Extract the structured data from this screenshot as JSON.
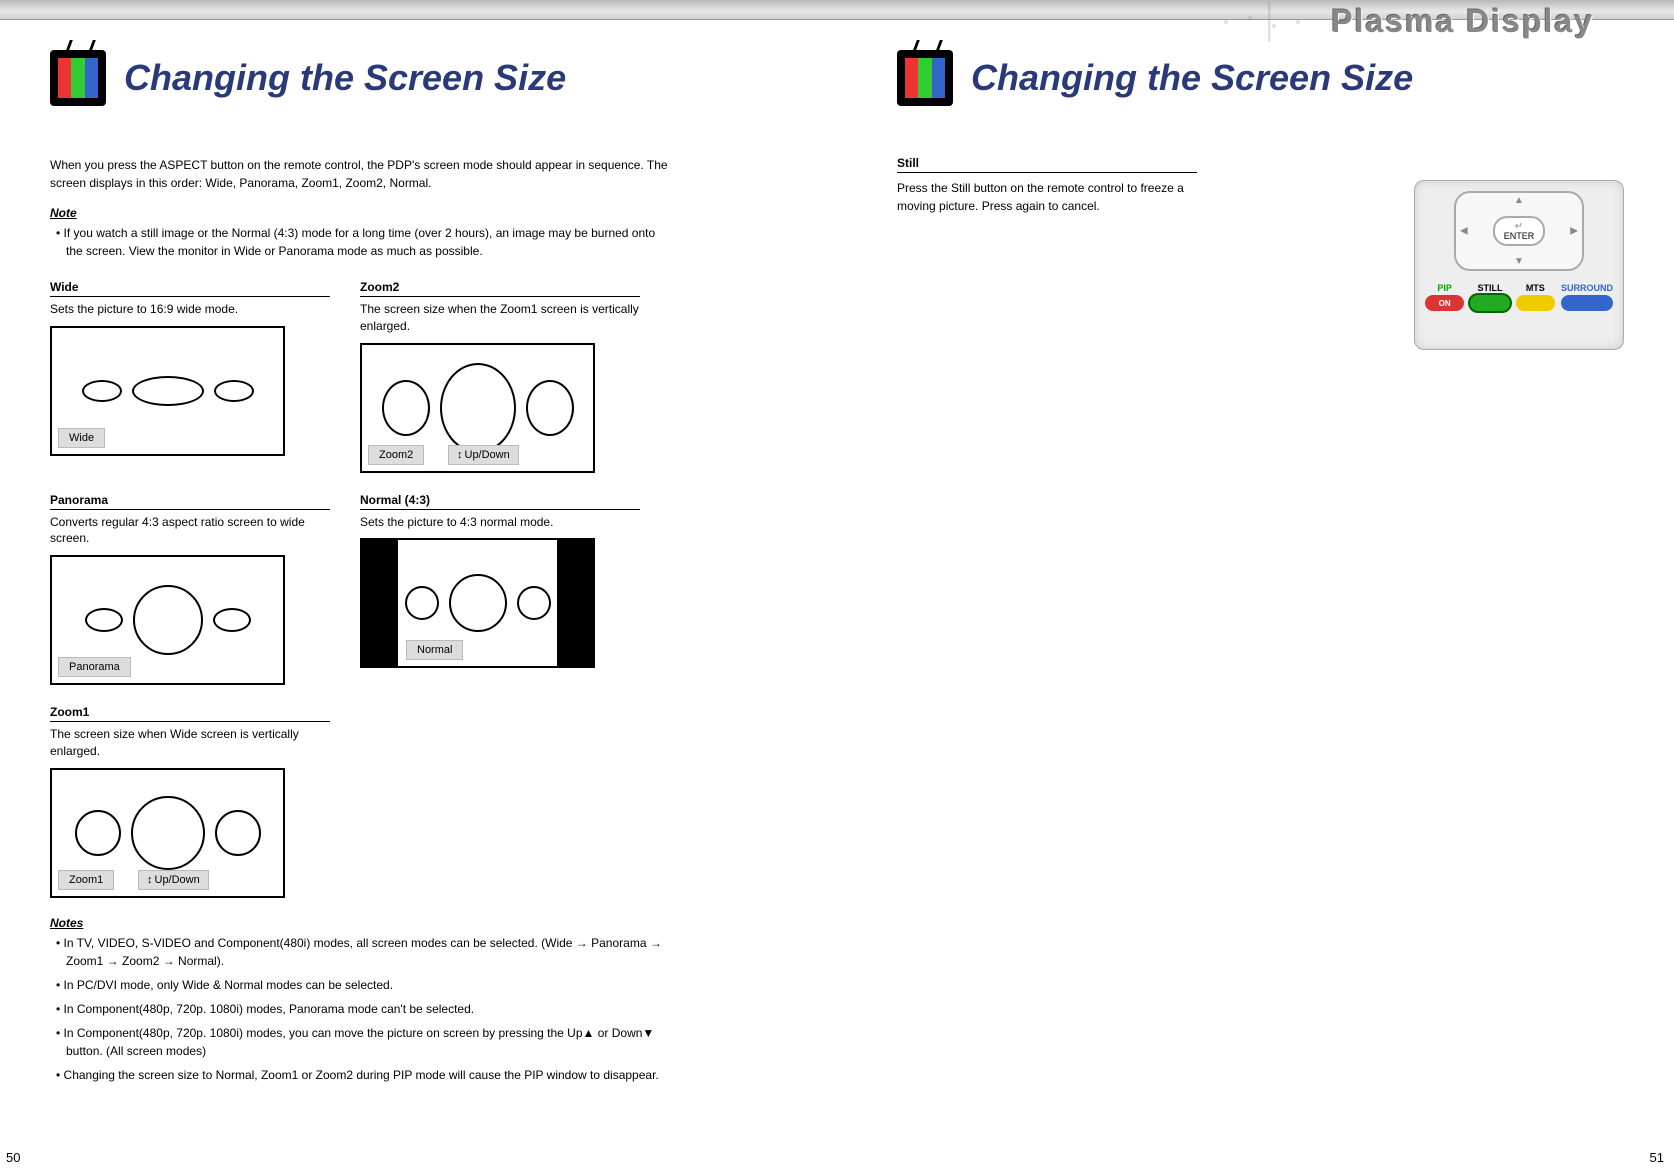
{
  "brand": "Plasma Display",
  "left": {
    "title": "Changing the Screen Size",
    "intro": "When you press the ASPECT button on the remote control, the PDP's screen mode should appear in sequence. The screen displays in this order: Wide, Panorama, Zoom1, Zoom2, Normal.",
    "note_heading": "Note",
    "note_bullet": "If you watch a still image or the Normal (4:3) mode for a long time (over 2 hours), an image may be burned onto the screen. View the monitor in Wide or Panorama mode as much as possible.",
    "modes": {
      "wide": {
        "title": "Wide",
        "desc": "Sets the picture to 16:9 wide mode.",
        "tag": "Wide"
      },
      "zoom2": {
        "title": "Zoom2",
        "desc": "The screen size when the Zoom1 screen is vertically enlarged.",
        "tag": "Zoom2",
        "updown": "Up/Down"
      },
      "panorama": {
        "title": "Panorama",
        "desc": "Converts regular 4:3 aspect ratio screen to wide screen.",
        "tag": "Panorama"
      },
      "normal": {
        "title": "Normal (4:3)",
        "desc": "Sets the picture to 4:3 normal mode.",
        "tag": "Normal"
      },
      "zoom1": {
        "title": "Zoom1",
        "desc": "The screen size when Wide screen is vertically enlarged.",
        "tag": "Zoom1",
        "updown": "Up/Down"
      }
    },
    "notes_heading": "Notes",
    "notes": [
      "In TV, VIDEO, S-VIDEO and Component(480i) modes, all screen modes can be selected. (Wide → Panorama → Zoom1 → Zoom2 → Normal).",
      "In PC/DVI mode, only Wide & Normal modes can be selected.",
      "In Component(480p, 720p. 1080i) modes, Panorama mode can't be selected.",
      "In Component(480p, 720p. 1080i) modes, you can move the picture on screen by pressing the Up▲ or Down▼ button. (All screen modes)",
      "Changing the screen size to Normal, Zoom1 or Zoom2 during PIP mode will cause the PIP window to disappear."
    ],
    "page_number": "50"
  },
  "right": {
    "title": "Changing the Screen Size",
    "still": {
      "title": "Still",
      "desc": "Press the Still button on the remote control to freeze a moving picture. Press again to cancel."
    },
    "remote": {
      "enter": "ENTER",
      "buttons": {
        "pip": {
          "label": "PIP",
          "sub": "ON"
        },
        "still": {
          "label": "STILL",
          "sub": ""
        },
        "mts": {
          "label": "MTS",
          "sub": ""
        },
        "surround": {
          "label": "SURROUND",
          "sub": ""
        }
      }
    },
    "page_number": "51"
  }
}
